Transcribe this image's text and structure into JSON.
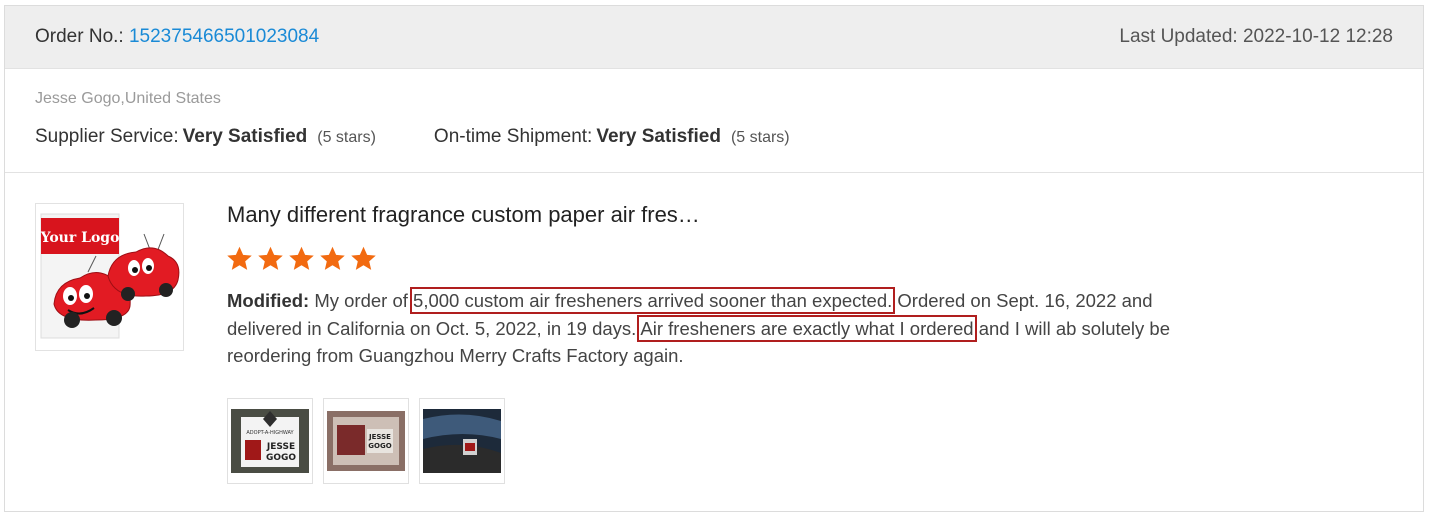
{
  "header": {
    "order_label": "Order No.:",
    "order_number": "152375466501023084",
    "last_updated": "Last Updated: 2022-10-12 12:28"
  },
  "reviewer": "Jesse Gogo,United States",
  "ratings": {
    "supplier_label": "Supplier Service:",
    "supplier_value": "Very Satisfied",
    "supplier_stars": "(5 stars)",
    "shipment_label": "On-time Shipment:",
    "shipment_value": "Very Satisfied",
    "shipment_stars": "(5 stars)"
  },
  "product": {
    "title": "Many different fragrance custom paper air fres…",
    "logo_text": "Your Logo",
    "star_count": 5,
    "star_color": "#f26a10"
  },
  "review": {
    "label": "Modified:",
    "part1": "My order of ",
    "highlight1": "5,000 custom air fresheners arrived sooner than expected.",
    "part2": " Ordered on Sept. 16, 2022 and delivered in California on Oct. 5, 2022, in 19 days. ",
    "highlight2": "Air fresheners are exactly what I ordered",
    "part3": " and I will ab solutely be reordering from Guangzhou Merry Crafts Factory again."
  },
  "photos": {
    "count": 3,
    "tag_text_line1": "JESSE",
    "tag_text_line2": "GOGO",
    "tag_caption": "ADOPT-A-HIGHWAY"
  },
  "colors": {
    "link": "#1a8ad6",
    "highlight_border": "#b01e1e",
    "header_bg": "#eeeeee"
  }
}
